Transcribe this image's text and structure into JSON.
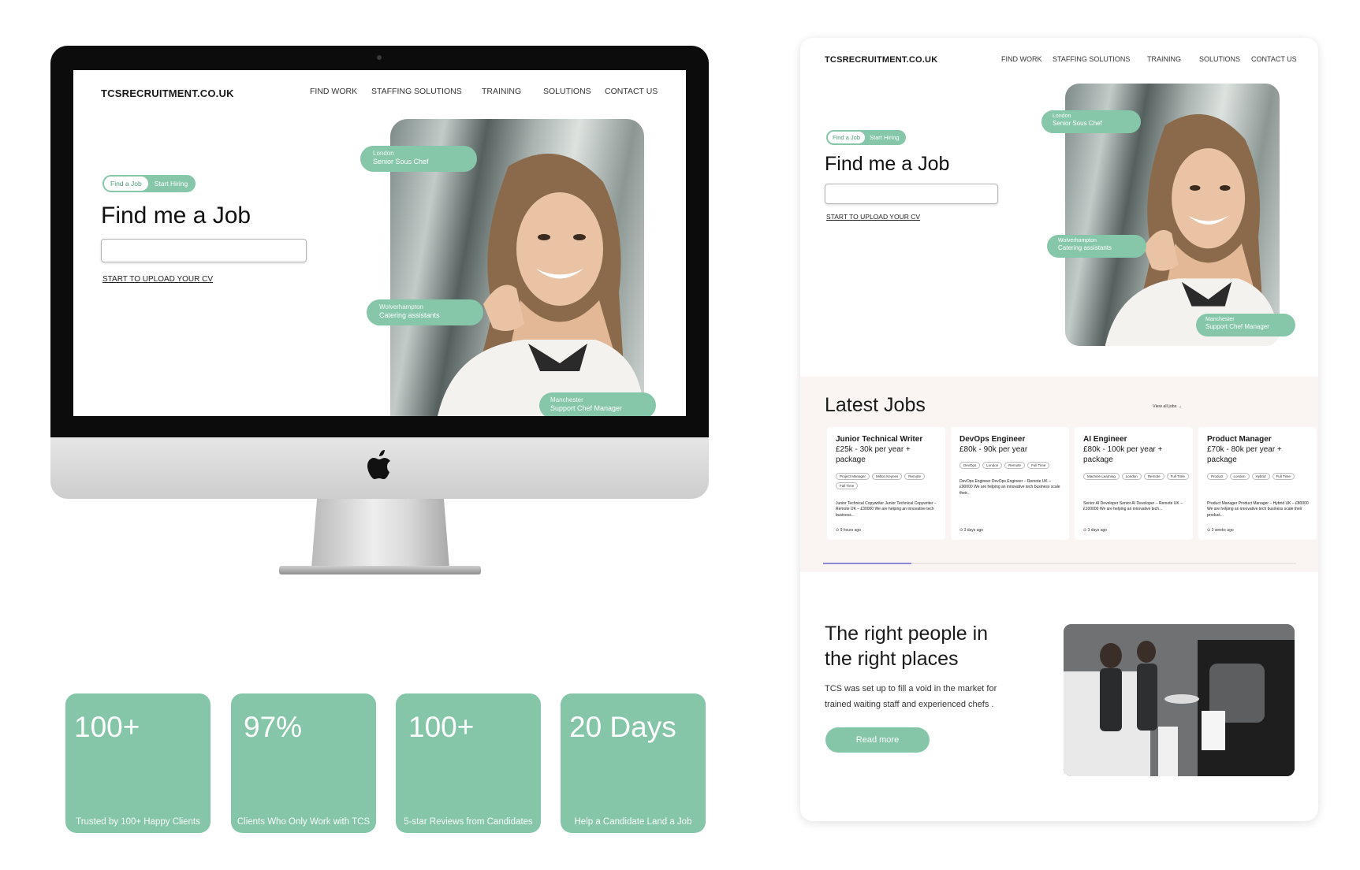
{
  "site": {
    "brand": "TCSRECRUITMENT.CO.UK",
    "nav": [
      "FIND WORK",
      "STAFFING SOLUTIONS",
      "TRAINING",
      "SOLUTIONS",
      "CONTACT US"
    ],
    "hero": {
      "tabs": [
        "Find a Job",
        "Start Hiring"
      ],
      "title": "Find me a Job",
      "search_value": "",
      "upload_link": "START TO UPLOAD YOUR CV",
      "tags": [
        {
          "location": "London",
          "role": "Senior Sous Chef"
        },
        {
          "location": "Wolverhampton",
          "role": "Catering assistants"
        },
        {
          "location": "Manchester",
          "role": "Support Chef Manager"
        }
      ]
    }
  },
  "stats": [
    {
      "value": "100+",
      "caption": "Trusted by 100+ Happy Clients"
    },
    {
      "value": "97%",
      "caption": "Clients Who Only Work with TCS"
    },
    {
      "value": "100+",
      "caption": "5-star Reviews from Candidates"
    },
    {
      "value": "20 Days",
      "caption": "Help a Candidate Land a Job"
    }
  ],
  "latest_jobs": {
    "title": "Latest Jobs",
    "view_all": "View all jobs →",
    "jobs": [
      {
        "title": "Junior Technical Writer",
        "salary": "£25k - 30k per year + package",
        "tags": [
          "Project Manager",
          "Milton Keynes",
          "Remote",
          "Full Time"
        ],
        "desc": "Junior Technical Copywriter    Junior Technical Copywriter – Remote UK – £30000 We are helping an innovative tech business...",
        "time": "⊙ 9 hours ago"
      },
      {
        "title": "DevOps Engineer",
        "salary": "£80k - 90k per year",
        "tags": [
          "DevOps",
          "London",
          "Remote",
          "Full Time"
        ],
        "desc": "DevOps Engineer DevOps Engineer – Remote UK – £90000    We are helping an innovative tech business scale their...",
        "time": "⊙ 3 days ago"
      },
      {
        "title": "AI Engineer",
        "salary": "£80k - 100k per year + package",
        "tags": [
          "Machine Learning",
          "London",
          "Remote",
          "Full Time"
        ],
        "desc": "Senior AI Developer    Senior AI Developer – Remote UK – £100000 We are helping an innovative tech...",
        "time": "⊙ 3 days ago"
      },
      {
        "title": "Product Manager",
        "salary": "£70k - 80k per year + package",
        "tags": [
          "Product",
          "London",
          "Hybrid",
          "Full Time"
        ],
        "desc": "Product Manager Product Manager – Hybrid UK – £80000    We are helping an innovative tech business scale their product...",
        "time": "⊙ 3 weeks ago"
      }
    ]
  },
  "about": {
    "title_line1": "The right people in",
    "title_line2": "the right places",
    "text_line1": "TCS was set up to fill a void in the market for",
    "text_line2": "trained waiting staff and experienced chefs .",
    "button": "Read more"
  },
  "colors": {
    "accent": "#85c6a9",
    "progress": "#8b89d1",
    "band": "#faf5f3"
  }
}
